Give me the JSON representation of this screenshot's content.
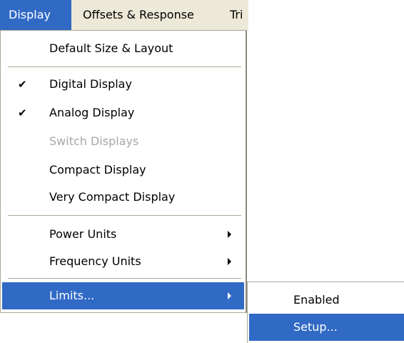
{
  "menubar": {
    "items": [
      {
        "label": "Display"
      },
      {
        "label": "Offsets & Response"
      },
      {
        "label": "Tri"
      }
    ]
  },
  "display_menu": {
    "items": [
      {
        "label": "Default Size & Layout"
      },
      {
        "label": "Digital Display",
        "checked": true,
        "check_glyph": "✔"
      },
      {
        "label": "Analog Display",
        "checked": true,
        "check_glyph": "✔"
      },
      {
        "label": "Switch Displays",
        "disabled": true
      },
      {
        "label": "Compact Display"
      },
      {
        "label": "Very Compact Display"
      },
      {
        "label": "Power Units",
        "submenu": true
      },
      {
        "label": "Frequency Units",
        "submenu": true
      },
      {
        "label": "Limits...",
        "submenu": true,
        "highlighted": true
      }
    ]
  },
  "limits_submenu": {
    "items": [
      {
        "label": "Enabled"
      },
      {
        "label": "Setup...",
        "highlighted": true
      }
    ]
  },
  "colors": {
    "highlight": "#316ac5",
    "menubar_bg": "#ece9d8",
    "disabled_text": "#a7a6aa"
  }
}
